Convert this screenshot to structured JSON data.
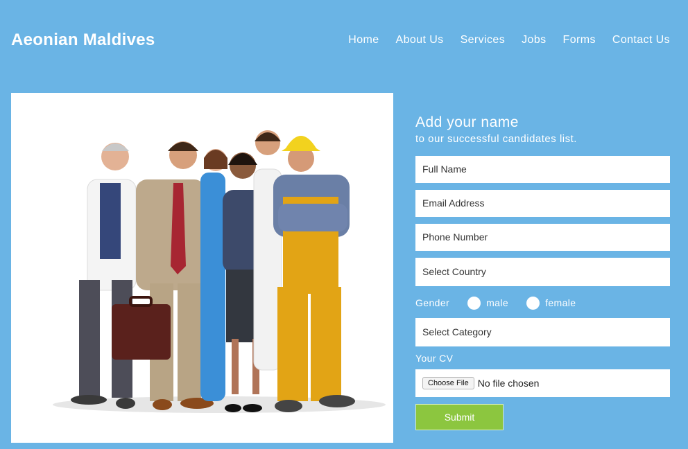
{
  "brand": "Aeonian Maldives",
  "nav": [
    "Home",
    "About Us",
    "Services",
    "Jobs",
    "Forms",
    "Contact Us"
  ],
  "form": {
    "heading": "Add your name",
    "subheading": "to our successful candidates list.",
    "full_name_placeholder": "Full Name",
    "email_placeholder": "Email Address",
    "phone_placeholder": "Phone Number",
    "country_select": "Select Country",
    "gender_label": "Gender",
    "gender_male": "male",
    "gender_female": "female",
    "category_select": "Select Category",
    "cv_label": "Your CV",
    "file_button": "Choose File",
    "file_status": "No file chosen",
    "submit": "Submit"
  },
  "colors": {
    "background": "#6ab4e5",
    "submit": "#8cc63f"
  }
}
